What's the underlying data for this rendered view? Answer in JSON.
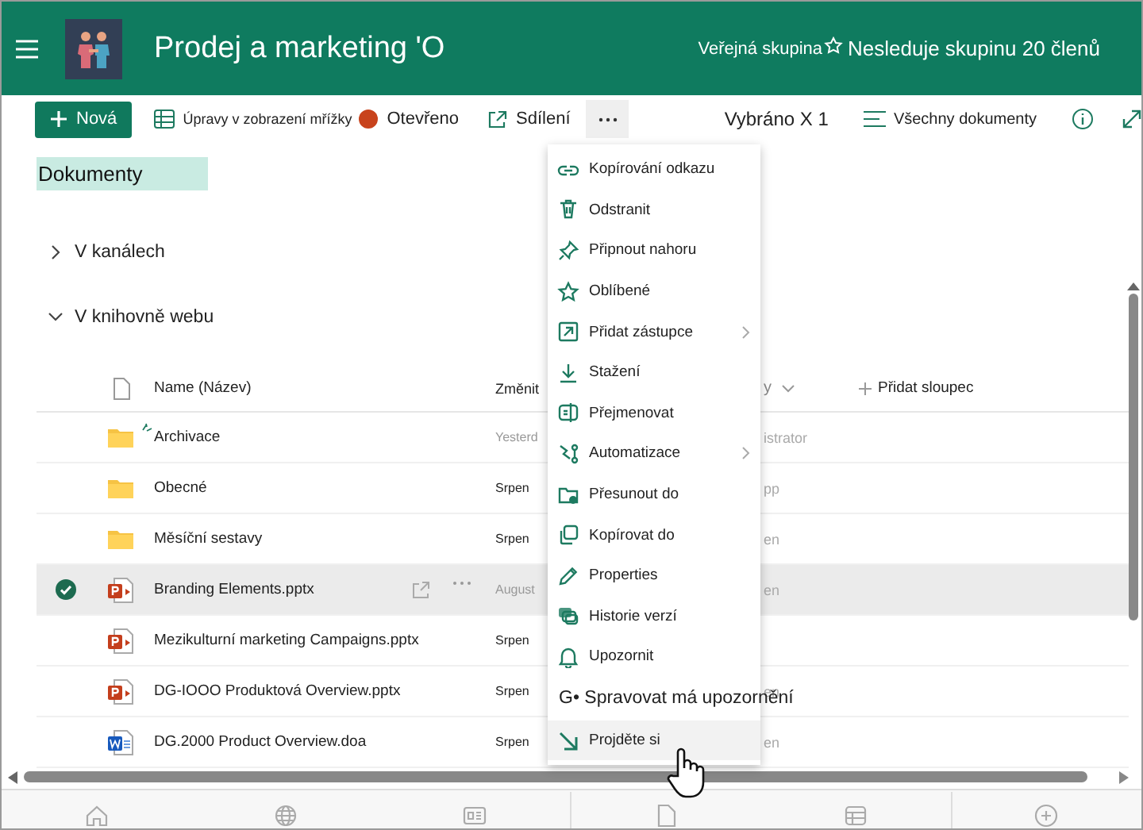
{
  "header": {
    "title": "Prodej a marketing 'O",
    "privacy": "Veřejná skupina",
    "follow": "Nesleduje skupinu 20 členů"
  },
  "toolbar": {
    "new": "Nová",
    "grid_edit": "Úpravy v zobrazení mřížky",
    "open": "Otevřeno",
    "share": "Sdílení",
    "selection": "Vybráno X 1",
    "view": "Všechny dokumenty"
  },
  "library": {
    "title": "Dokumenty",
    "sections": [
      {
        "label": "V kanálech",
        "expanded": false
      },
      {
        "label": "V knihovně webu",
        "expanded": true
      }
    ]
  },
  "table": {
    "columns": [
      "Name (Název)",
      "Změnit",
      "y",
      "Přidat sloupec"
    ],
    "rows": [
      {
        "kind": "folder",
        "name": "Archivace",
        "new": true,
        "selected": false,
        "modified": "Yesterd",
        "column_4": "istrator"
      },
      {
        "kind": "folder",
        "name": "Obecné",
        "new": false,
        "selected": false,
        "modified": "Srpen",
        "column_4": "pp"
      },
      {
        "kind": "folder",
        "name": "Měsíční sestavy",
        "new": false,
        "selected": false,
        "modified": "Srpen",
        "column_4": "en"
      },
      {
        "kind": "pptx",
        "name": "Branding Elements.pptx",
        "new": false,
        "selected": true,
        "modified": "August",
        "column_4": "en"
      },
      {
        "kind": "pptx",
        "name": "Mezikulturní marketing Campaigns.pptx",
        "new": false,
        "selected": false,
        "modified": "Srpen"
      },
      {
        "kind": "pptx",
        "name": "DG-IOOO Produktová Overview.pptx",
        "new": false,
        "selected": false,
        "modified": "Srpen",
        "column_4": "en"
      },
      {
        "kind": "docx",
        "name": "DG.2000 Product Overview.doa",
        "new": false,
        "selected": false,
        "modified": "Srpen",
        "column_4": "en"
      }
    ]
  },
  "menu": {
    "items": [
      {
        "kind": "icon",
        "label": "Kopírování odkazu",
        "submenu": false,
        "selected": false
      },
      {
        "kind": "icon",
        "label": "Odstranit",
        "submenu": false,
        "selected": false
      },
      {
        "kind": "icon",
        "label": "Připnout nahoru",
        "submenu": false,
        "selected": false
      },
      {
        "kind": "icon",
        "label": "Oblíbené",
        "submenu": false,
        "selected": false
      },
      {
        "kind": "icon",
        "label": "Přidat zástupce",
        "submenu": true,
        "selected": false
      },
      {
        "kind": "icon",
        "label": "Stažení",
        "submenu": false,
        "selected": false
      },
      {
        "kind": "icon",
        "label": "Přejmenovat",
        "submenu": false,
        "selected": false
      },
      {
        "kind": "icon",
        "label": "Automatizace",
        "submenu": true,
        "selected": false
      },
      {
        "kind": "icon",
        "label": "Přesunout do",
        "submenu": false,
        "selected": false
      },
      {
        "kind": "icon",
        "label": "Kopírovat do",
        "submenu": false,
        "selected": false
      },
      {
        "kind": "icon",
        "label": "Properties",
        "submenu": false,
        "selected": false
      },
      {
        "kind": "icon",
        "label": "Historie verzí",
        "submenu": false,
        "selected": false
      },
      {
        "kind": "icon",
        "label": "Upozornit",
        "submenu": false,
        "selected": false
      },
      {
        "kind": "text",
        "label": "G• Spravovat má upozornění",
        "submenu": false,
        "selected": false
      },
      {
        "kind": "icon",
        "label": "Projděte si",
        "submenu": false,
        "selected": true
      }
    ]
  }
}
